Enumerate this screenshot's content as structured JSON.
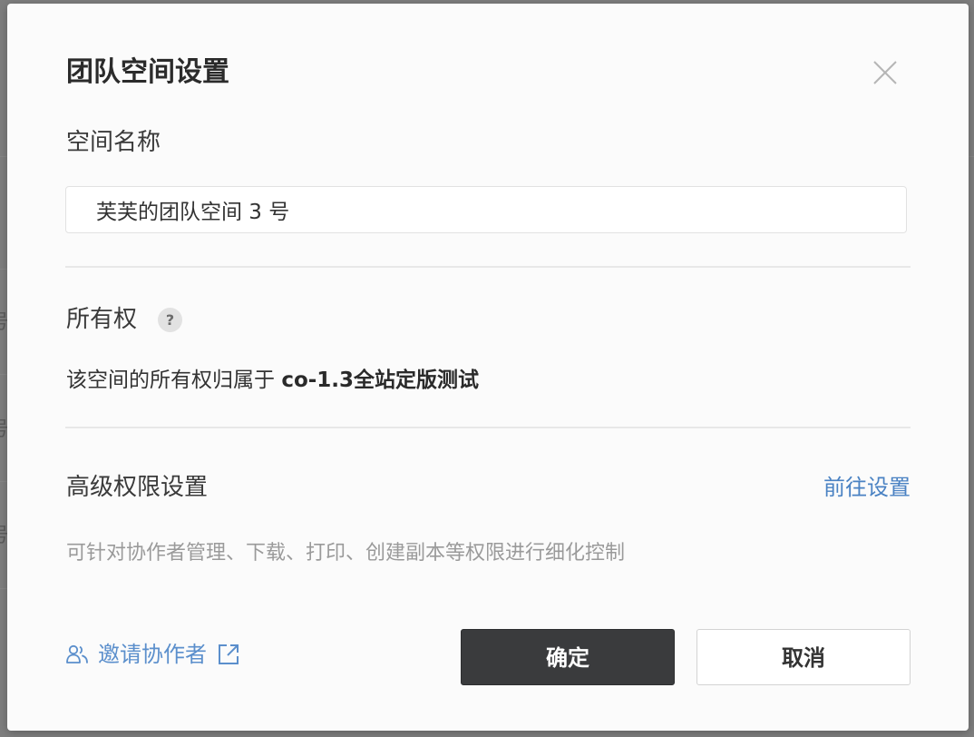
{
  "modal": {
    "title": "团队空间设置",
    "name_section": {
      "label": "空间名称",
      "value": "芙芙的团队空间 3 号"
    },
    "ownership_section": {
      "label": "所有权",
      "help_glyph": "?",
      "text_prefix": "该空间的所有权归属于 ",
      "owner_name": "co-1.3全站定版测试"
    },
    "advanced_section": {
      "label": "高级权限设置",
      "link": "前往设置",
      "description": "可针对协作者管理、下载、打印、创建副本等权限进行细化控制"
    },
    "footer": {
      "invite_label": "邀请协作者",
      "confirm_label": "确定",
      "cancel_label": "取消"
    }
  },
  "background": {
    "edge_glyphs": [
      "号",
      "号",
      "号"
    ]
  },
  "colors": {
    "link": "#4a82c3",
    "primary_button": "#3a3b3d"
  },
  "icons": {
    "close": "close-icon",
    "help": "question-icon",
    "invite": "people-icon",
    "external": "external-link-icon"
  }
}
